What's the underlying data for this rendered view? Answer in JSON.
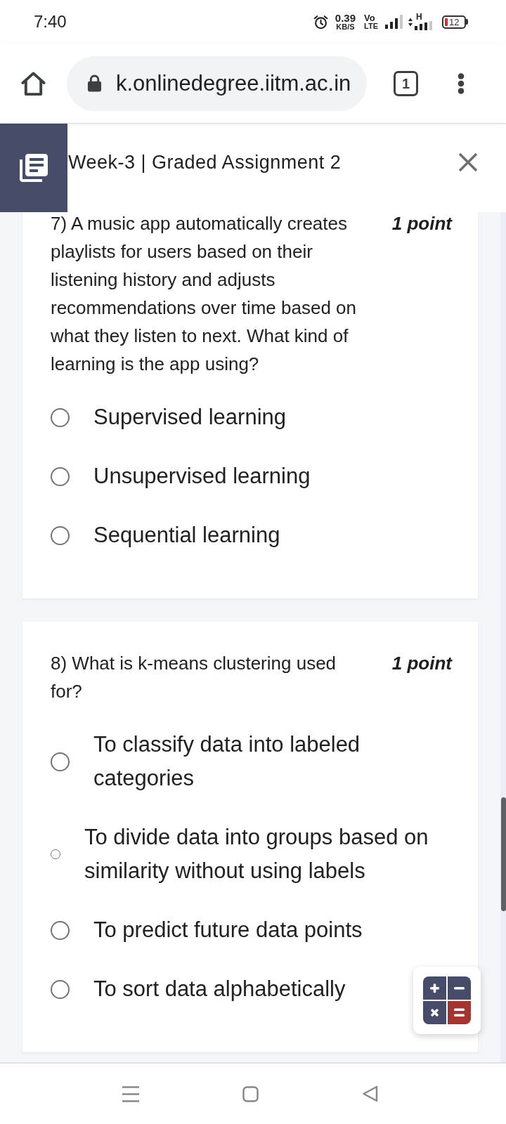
{
  "status_bar": {
    "time": "7:40",
    "data_speed": "0.39",
    "data_speed_unit": "KB/S",
    "volte_top": "Vo",
    "volte_bottom": "LTE",
    "network_type": "H",
    "battery": "12"
  },
  "browser": {
    "url": "k.onlinedegree.iitm.ac.in",
    "tab_count": "1"
  },
  "header": {
    "title": "Week-3 | Graded Assignment 2"
  },
  "questions": [
    {
      "text": "7) A music app automatically creates playlists for users based on their listening history and adjusts recommendations over time based on what they listen to next. What kind of learning is the app using?",
      "points": "1 point",
      "options": [
        {
          "label": "Supervised learning",
          "kind": "radio",
          "selected": false
        },
        {
          "label": "Unsupervised learning",
          "kind": "radio",
          "selected": false
        },
        {
          "label": "Sequential learning",
          "kind": "radio",
          "selected": false
        }
      ]
    },
    {
      "text": "8) What is k-means clustering used for?",
      "points": "1 point",
      "options": [
        {
          "label": "To classify data into labeled categories",
          "kind": "radio",
          "selected": false
        },
        {
          "label": "To divide data into groups based on similarity without using labels",
          "kind": "radio-small",
          "selected": false
        },
        {
          "label": "To predict future data points",
          "kind": "radio",
          "selected": false
        },
        {
          "label": "To sort data alphabetically",
          "kind": "radio",
          "selected": false
        }
      ]
    }
  ]
}
